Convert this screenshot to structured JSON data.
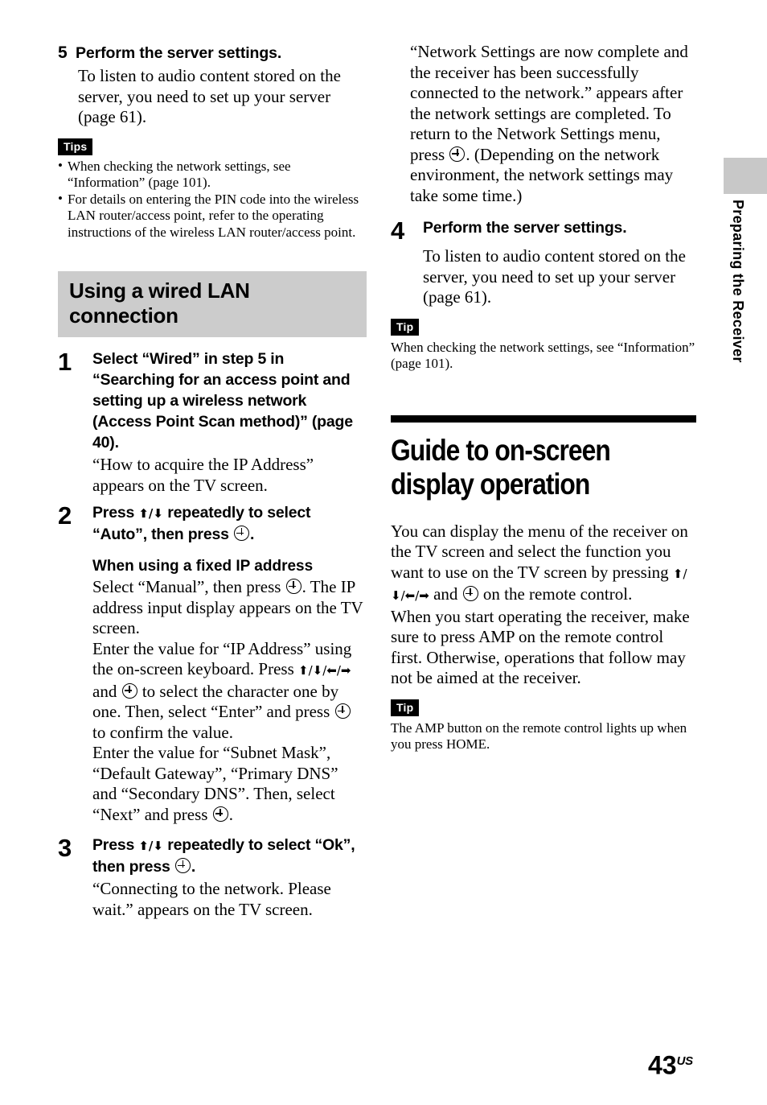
{
  "page": {
    "number": "43",
    "region_mark": "US"
  },
  "side_tab": {
    "label": "Preparing the Receiver"
  },
  "left_column": {
    "step5": {
      "number": "5",
      "title": "Perform the server settings.",
      "body": "To listen to audio content stored on the server, you need to set up your server (page 61)."
    },
    "tips_badge": "Tips",
    "tips": [
      "When checking the network settings, see “Information” (page 101).",
      "For details on entering the PIN code into the wireless LAN router/access point, refer to the operating instructions of the wireless LAN router/access point."
    ],
    "section_heading": "Using a wired LAN connection",
    "step1": {
      "number": "1",
      "title": "Select “Wired” in step 5 in “Searching for an access point and setting up a wireless network (Access Point Scan method)” (page 40).",
      "body": "“How to acquire the IP Address” appears on the TV screen."
    },
    "step2": {
      "number": "2",
      "title_part1": "Press ",
      "arrows": "⬆/⬇",
      "title_part2": " repeatedly to select “Auto”, then press ",
      "title_end": ".",
      "subheading": "When using a fixed IP address",
      "body_p1_a": "Select “Manual”, then press ",
      "body_p1_b": ". The IP address input display appears on the TV screen.",
      "body_p2_a": "Enter the value for “IP Address” using the on-screen keyboard. Press ",
      "body_p2_arrows": "⬆/⬇/⬅/➡",
      "body_p2_b": " and ",
      "body_p2_c": " to select the character one by one. Then, select “Enter” and press ",
      "body_p2_d": " to confirm the value.",
      "body_p3_a": "Enter the value for “Subnet Mask”, “Default Gateway”, “Primary DNS” and “Secondary DNS”. Then, select “Next” and press ",
      "body_p3_b": "."
    },
    "step3": {
      "number": "3",
      "title_part1": "Press ",
      "arrows": "⬆/⬇",
      "title_part2": " repeatedly to select “Ok”, then press ",
      "title_end": ".",
      "body": "“Connecting to the network. Please wait.” appears on the TV screen."
    }
  },
  "right_column": {
    "intro_a": "“Network Settings are now complete and the receiver has been successfully connected to the network.” appears after the network settings are completed. To return to the Network Settings menu, press ",
    "intro_b": ". (Depending on the network environment, the network settings may take some time.)",
    "step4": {
      "number": "4",
      "title": "Perform the server settings.",
      "body": "To listen to audio content stored on the server, you need to set up your server (page 61)."
    },
    "tip_badge_1": "Tip",
    "tip_text_1": "When checking the network settings, see “Information” (page 101).",
    "chapter_heading": "Guide to on-screen display operation",
    "guide_p1_a": "You can display the menu of the receiver on the TV screen and select the function you want to use on the TV screen by pressing ",
    "guide_p1_arrows": "⬆/⬇/⬅/➡",
    "guide_p1_b": " and ",
    "guide_p1_c": " on the remote control.",
    "guide_p2": "When you start operating the receiver, make sure to press AMP on the remote control first. Otherwise, operations that follow may not be aimed at the receiver.",
    "tip_badge_2": "Tip",
    "tip_text_2": "The AMP button on the remote control lights up when you press HOME."
  },
  "colors": {
    "gray_heading_bg": "#cccccc",
    "side_tab_gray": "#c8c8c8",
    "rule_black": "#000000"
  }
}
